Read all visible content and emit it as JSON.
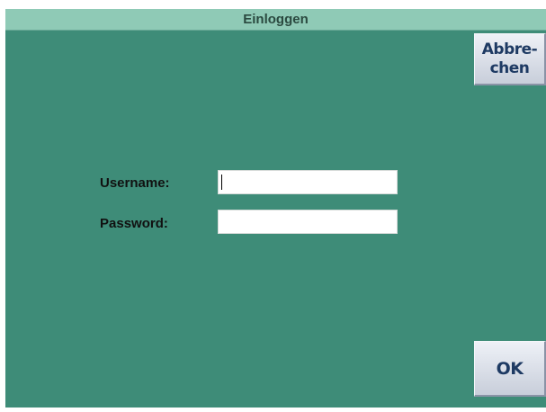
{
  "window": {
    "title": "Einloggen"
  },
  "buttons": {
    "cancel_label": "Abbre-\nchen",
    "ok_label": "OK"
  },
  "form": {
    "username_label": "Username:",
    "username_value": "",
    "password_label": "Password:",
    "password_value": ""
  },
  "colors": {
    "background": "#3e8c78",
    "titlebar": "#8fcab6",
    "button_text": "#1e3a63"
  }
}
